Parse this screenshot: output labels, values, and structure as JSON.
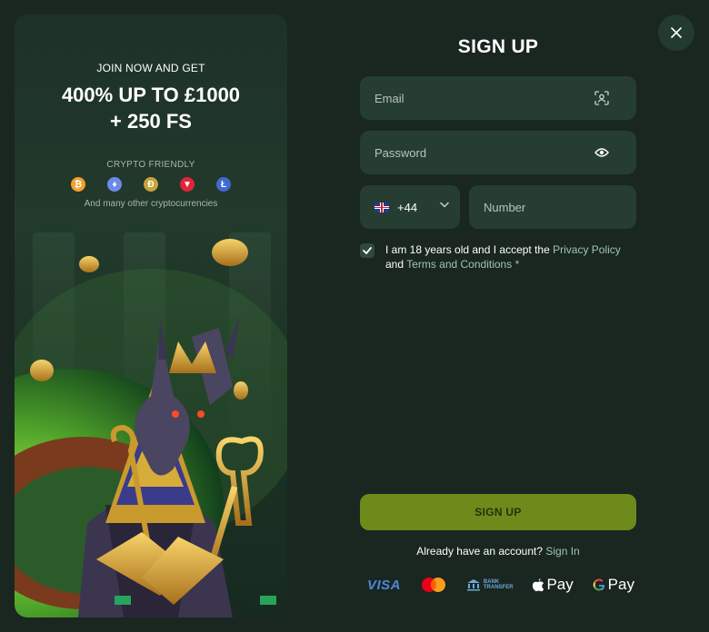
{
  "promo": {
    "headline": "JOIN NOW AND GET",
    "bonus_line1": "400% UP TO £1000",
    "bonus_line2": "+ 250 FS",
    "crypto_label": "CRYPTO FRIENDLY",
    "crypto_icons": [
      "bitcoin-icon",
      "ethereum-icon",
      "dogecoin-icon",
      "tron-icon",
      "litecoin-icon"
    ],
    "crypto_more": "And many other cryptocurrencies"
  },
  "form": {
    "title": "SIGN UP",
    "email_placeholder": "Email",
    "password_placeholder": "Password",
    "phone_code": "+44",
    "phone_flag": "uk-flag-icon",
    "number_placeholder": "Number",
    "consent_checked": true,
    "consent_prefix": "I am 18 years old and I accept the",
    "privacy_link": "Privacy Policy",
    "consent_and": "and",
    "terms_link": "Terms and Conditions",
    "required_mark": "*",
    "submit_label": "SIGN UP",
    "have_account": "Already have an account?",
    "signin_link": "Sign In"
  },
  "payments": {
    "visa": "VISA",
    "mastercard": "mastercard-icon",
    "bank_line1": "BANK",
    "bank_line2": "TRANSFER",
    "apple_pay": "Pay",
    "google_pay": "Pay"
  },
  "colors": {
    "background": "#1a2620",
    "field": "#263d32",
    "accent_button": "#6e8a1b",
    "link": "#9fc5b4"
  }
}
